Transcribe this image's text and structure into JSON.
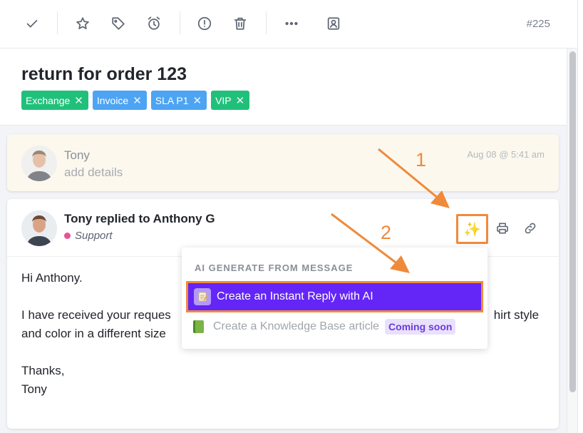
{
  "toolbar": {
    "icons": [
      "check-icon",
      "star-icon",
      "tag-icon",
      "alarm-clock-icon",
      "alert-circle-icon",
      "trash-icon",
      "more-icon",
      "contact-card-icon"
    ],
    "ticket_number": "#225"
  },
  "ticket": {
    "title": "return for order 123",
    "tags": [
      {
        "label": "Exchange",
        "color": "#21c07a"
      },
      {
        "label": "Invoice",
        "color": "#4ca4f3"
      },
      {
        "label": "SLA P1",
        "color": "#4ca4f3"
      },
      {
        "label": "VIP",
        "color": "#21c07a"
      }
    ],
    "tag_remove_glyph": "✕"
  },
  "note": {
    "author": "Tony",
    "placeholder": "add details",
    "time": "Aug 08 @ 5:41 am"
  },
  "reply": {
    "heading": "Tony replied to Anthony G",
    "channel": "Support",
    "channel_color": "#e6529b",
    "body": {
      "greeting": "Hi Anthony.",
      "line1_start": "I have received your reques",
      "line1_end": "hirt style",
      "line2": "and color in a different size",
      "signoff": "Thanks,",
      "name": "Tony"
    },
    "actions": [
      "sparkles-icon",
      "printer-icon",
      "link-icon"
    ]
  },
  "ai_menu": {
    "heading": "AI GENERATE FROM MESSAGE",
    "items": [
      {
        "label": "Create an Instant Reply with AI",
        "icon": "notepad-icon",
        "highlighted": true
      },
      {
        "label": "Create a Knowledge Base article",
        "icon": "green-book-icon",
        "badge": "Coming soon"
      }
    ]
  },
  "annotations": {
    "step1": "1",
    "step2": "2",
    "color": "#ef8a3a"
  },
  "colors": {
    "accent_purple": "#6425f7",
    "highlight_orange": "#f08a3c"
  }
}
